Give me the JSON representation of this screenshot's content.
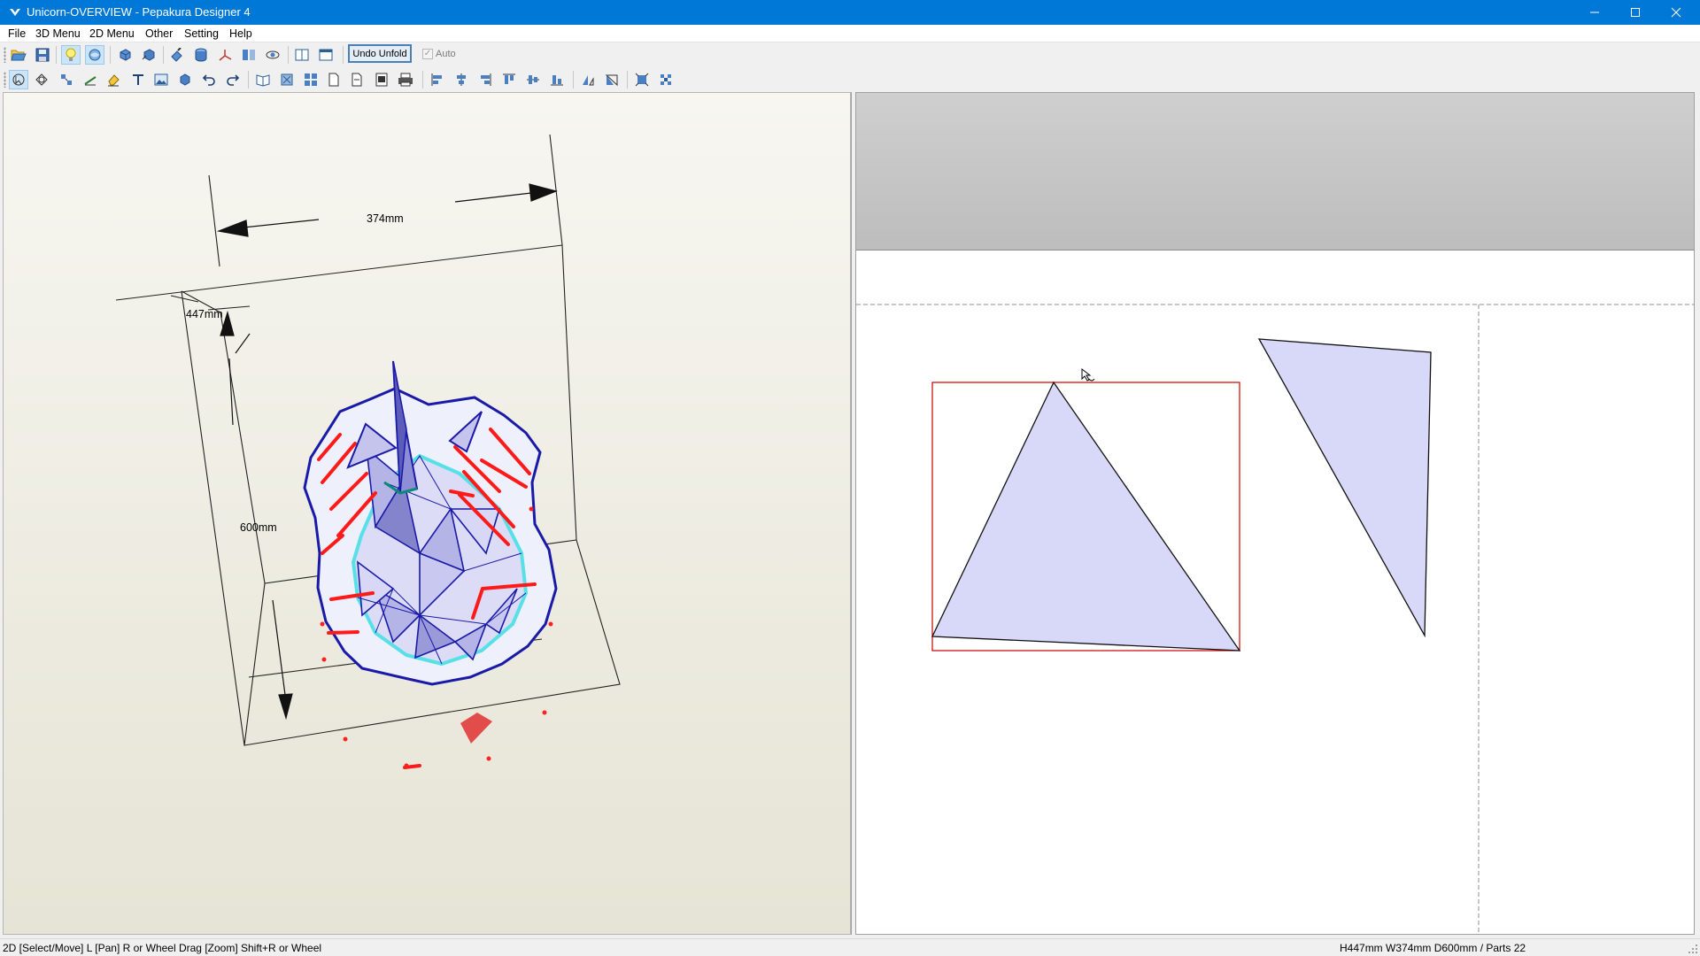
{
  "window": {
    "title": "Unicorn-OVERVIEW - Pepakura Designer 4",
    "titlebar_color": "#0078d7",
    "controls": [
      "minimize-icon",
      "maximize-icon",
      "close-icon"
    ]
  },
  "menubar": {
    "items": [
      "File",
      "3D Menu",
      "2D Menu",
      "Other",
      "Setting",
      "Help"
    ]
  },
  "toolbar1": {
    "undo_unfold_label": "Undo Unfold",
    "auto_label": "Auto",
    "auto_checked": true,
    "auto_enabled": false,
    "icons": [
      "open-icon",
      "save-icon",
      "light-icon",
      "texture-icon",
      "rotate-left-icon",
      "rotate-right-icon",
      "paint-icon",
      "cylinder-icon",
      "axis-icon",
      "split-view-icon",
      "display-settings-icon",
      "layout-two-icon",
      "layout-one-icon"
    ]
  },
  "toolbar2": {
    "icons": [
      "select-move-icon",
      "select-3d-icon",
      "arrange-icon",
      "line-icon",
      "eraser-icon",
      "text-icon",
      "image-icon",
      "rotate-part-icon",
      "undo-icon",
      "redo-icon",
      "book-icon",
      "scale-icon",
      "grid-icon",
      "page-icon",
      "page-add-icon",
      "snapshot-icon",
      "print-icon",
      "align-left-icon",
      "align-center-icon",
      "align-right-icon",
      "align-top-icon",
      "align-middle-icon",
      "align-bottom-icon",
      "flip-h-icon",
      "flip-v-icon",
      "fit-icon",
      "distribute-icon"
    ]
  },
  "view3d": {
    "dimensions": {
      "width": "374mm",
      "height": "600mm",
      "depth": "447mm"
    },
    "colors": {
      "edge": "#1a1aa8",
      "fold": "#ff1a1a",
      "cut": "#58e0e8",
      "face": "#d9d9f5"
    }
  },
  "view2d": {
    "part_fill": "#d8d8f8",
    "selection_color": "#cc0000"
  },
  "statusbar": {
    "hint": "2D [Select/Move] L [Pan] R or Wheel Drag [Zoom] Shift+R or Wheel",
    "info": "H447mm W374mm D600mm / Parts 22"
  }
}
